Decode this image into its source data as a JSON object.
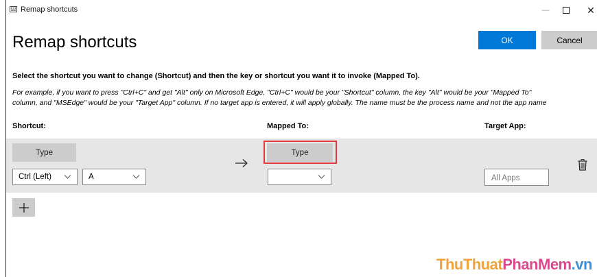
{
  "window": {
    "title": "Remap shortcuts",
    "minimize_glyph": "—",
    "close_glyph": "✕"
  },
  "heading": "Remap shortcuts",
  "buttons": {
    "ok": "OK",
    "cancel": "Cancel"
  },
  "instruction": "Select the shortcut you want to change (Shortcut) and then the key or shortcut you want it to invoke (Mapped To).",
  "example": {
    "line1": "For example, if you want to press \"Ctrl+C\" and get \"Alt\" only on Microsoft Edge, \"Ctrl+C\" would be your \"Shortcut\" column, the key \"Alt\" would be your \"Mapped To\"",
    "line2": "column, and \"MSEdge\" would be your \"Target App\" column. If no target app is entered, it will apply globally. The name must be the process name and not the app name"
  },
  "columns": {
    "shortcut": "Shortcut:",
    "mapped_to": "Mapped To:",
    "target_app": "Target App:"
  },
  "row": {
    "shortcut_type_label": "Type",
    "shortcut_modifier": "Ctrl (Left)",
    "shortcut_key": "A",
    "mapped_type_label": "Type",
    "mapped_value": "",
    "target_app_placeholder": "All Apps"
  },
  "icons": {
    "app": "keyboard-icon",
    "arrow": "arrow-right-icon",
    "delete": "trash-icon",
    "add": "plus-icon",
    "dropdown": "chevron-down-icon"
  },
  "colors": {
    "accent": "#0078d7",
    "highlight": "#e0393e",
    "row_bg": "#e6e6e6",
    "button_bg": "#cccccc"
  },
  "watermark": {
    "part1": "ThuThuat",
    "part2": "PhanMem",
    "part3": ".vn"
  }
}
